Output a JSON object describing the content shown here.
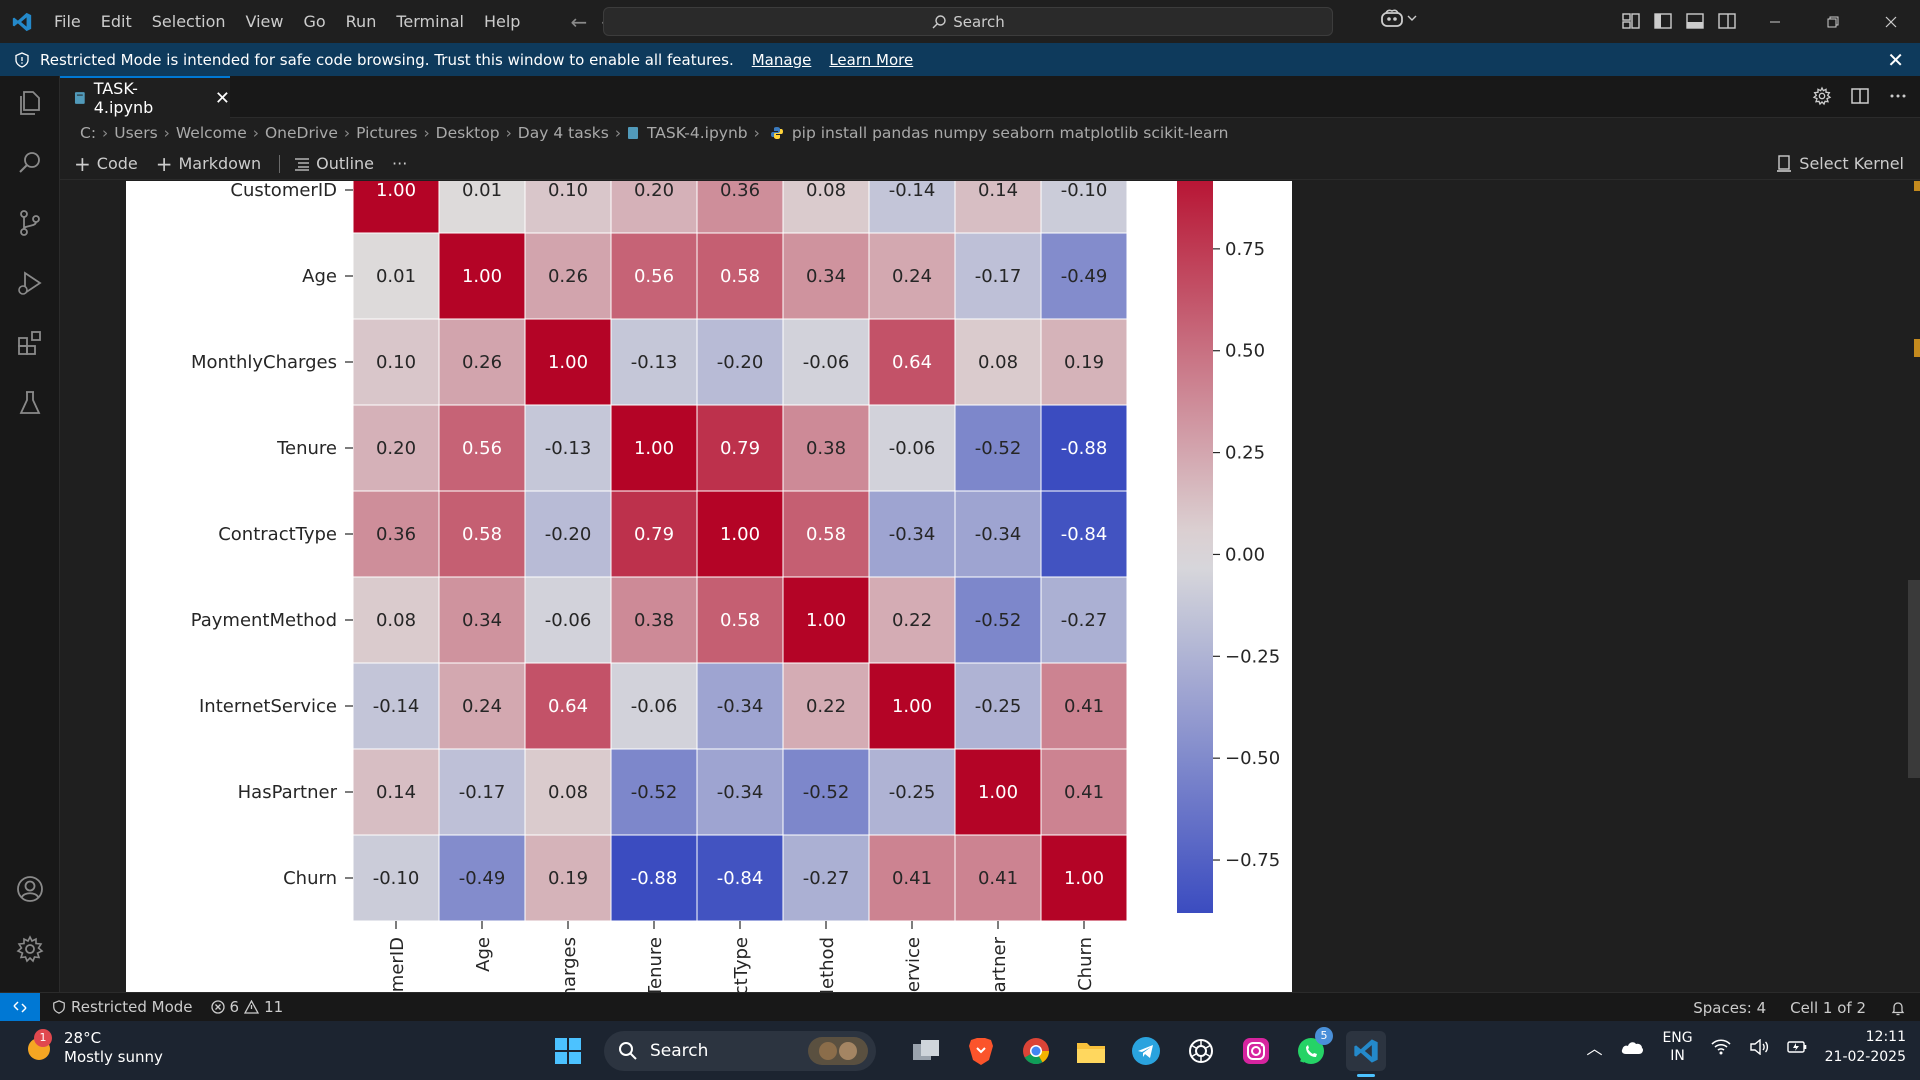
{
  "menu": [
    "File",
    "Edit",
    "Selection",
    "View",
    "Go",
    "Run",
    "Terminal",
    "Help"
  ],
  "command_center": {
    "label": "Search"
  },
  "banner": {
    "message": "Restricted Mode is intended for safe code browsing. Trust this window to enable all features.",
    "manage": "Manage",
    "learn_more": "Learn More"
  },
  "tab": {
    "label": "TASK-4.ipynb"
  },
  "breadcrumb": [
    "C:",
    "Users",
    "Welcome",
    "OneDrive",
    "Pictures",
    "Desktop",
    "Day 4 tasks",
    "TASK-4.ipynb",
    "pip install pandas numpy seaborn matplotlib scikit-learn"
  ],
  "toolbar": {
    "code": "Code",
    "markdown": "Markdown",
    "outline": "Outline",
    "more": "···",
    "kernel": "Select Kernel"
  },
  "chart_data": {
    "type": "heatmap",
    "row_labels": [
      "CustomerID",
      "Age",
      "MonthlyCharges",
      "Tenure",
      "ContractType",
      "PaymentMethod",
      "InternetService",
      "HasPartner",
      "Churn"
    ],
    "col_labels_visible": [
      "omerID",
      "Age",
      "Charges",
      "Tenure",
      "actType",
      "Method",
      "Service",
      "Partner",
      "Churn"
    ],
    "values": [
      [
        1.0,
        0.01,
        0.1,
        0.2,
        0.36,
        0.08,
        -0.14,
        0.14,
        -0.1
      ],
      [
        0.01,
        1.0,
        0.26,
        0.56,
        0.58,
        0.34,
        0.24,
        -0.17,
        -0.49
      ],
      [
        0.1,
        0.26,
        1.0,
        -0.13,
        -0.2,
        -0.06,
        0.64,
        0.08,
        0.19
      ],
      [
        0.2,
        0.56,
        -0.13,
        1.0,
        0.79,
        0.38,
        -0.06,
        -0.52,
        -0.88
      ],
      [
        0.36,
        0.58,
        -0.2,
        0.79,
        1.0,
        0.58,
        -0.34,
        -0.34,
        -0.84
      ],
      [
        0.08,
        0.34,
        -0.06,
        0.38,
        0.58,
        1.0,
        0.22,
        -0.52,
        -0.27
      ],
      [
        -0.14,
        0.24,
        0.64,
        -0.06,
        -0.34,
        0.22,
        1.0,
        -0.25,
        0.41
      ],
      [
        0.14,
        -0.17,
        0.08,
        -0.52,
        -0.34,
        -0.52,
        -0.25,
        1.0,
        0.41
      ],
      [
        -0.1,
        -0.49,
        0.19,
        -0.88,
        -0.84,
        -0.27,
        0.41,
        0.41,
        1.0
      ]
    ],
    "colorbar_ticks": [
      "0.75",
      "0.50",
      "0.25",
      "0.00",
      "−0.25",
      "−0.50",
      "−0.75"
    ],
    "colorbar_tick_values": [
      0.75,
      0.5,
      0.25,
      0.0,
      -0.25,
      -0.5,
      -0.75
    ],
    "vmin": -0.88,
    "vmax": 1.0,
    "colormap": "coolwarm",
    "cmap_colors": [
      "#3b4cc0",
      "#dddcdc",
      "#b40426"
    ]
  },
  "status": {
    "mode": "Restricted Mode",
    "errors": "6",
    "warnings": "11",
    "spaces": "Spaces: 4",
    "cell": "Cell 1 of 2"
  },
  "taskbar": {
    "weather_temp": "28°C",
    "weather_desc": "Mostly sunny",
    "weather_badge": "1",
    "search": "Search",
    "whatsapp_badge": "5",
    "lang_1": "ENG",
    "lang_2": "IN",
    "time": "12:11",
    "date": "21-02-2025"
  },
  "colors": {
    "accent": "#0078d4",
    "banner": "#0e3a5c",
    "editor_bg": "#1f1f1f",
    "taskbar": "#1c2430"
  }
}
